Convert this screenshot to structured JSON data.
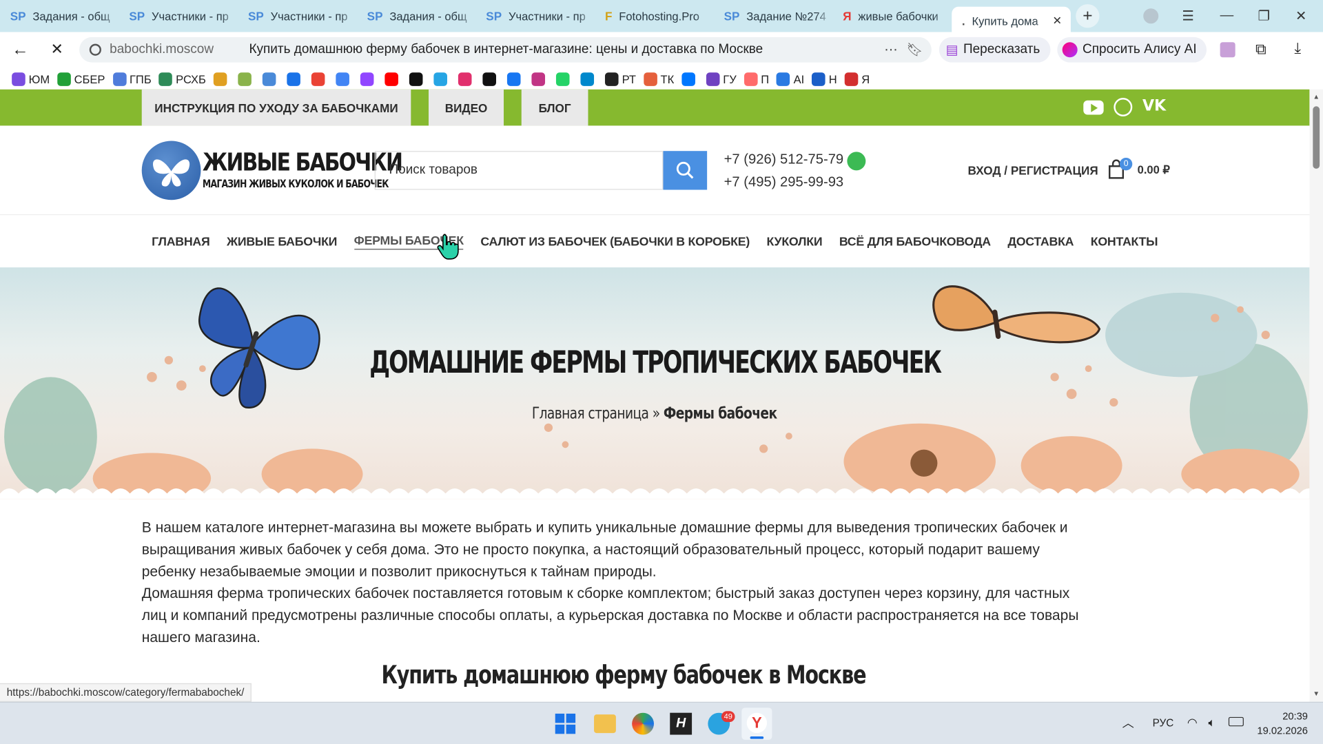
{
  "browser": {
    "tabs": [
      {
        "label": "Задания - общ",
        "favicon": "SP"
      },
      {
        "label": "Участники - пр",
        "favicon": "SP"
      },
      {
        "label": "Участники - пр",
        "favicon": "SP"
      },
      {
        "label": "Задания - общ",
        "favicon": "SP"
      },
      {
        "label": "Участники - пр",
        "favicon": "SP"
      },
      {
        "label": "Fotohosting.Pro",
        "favicon": "F"
      },
      {
        "label": "Задание №274",
        "favicon": "SP"
      },
      {
        "label": "живые бабочки",
        "favicon": "Я"
      },
      {
        "label": "Купить дома",
        "favicon": "."
      }
    ],
    "url_domain": "babochki.moscow",
    "page_title": "Купить домашнюю ферму бабочек в интернет-магазине: цены и доставка по Москве",
    "retell_label": "Пересказать",
    "alice_label": "Спросить Алису AI",
    "bookmarks": [
      "ЮМ",
      "СБЕР",
      "ГПБ",
      "РСХБ",
      "",
      "",
      "",
      "",
      "",
      "",
      "",
      "",
      "",
      "",
      "",
      "",
      "",
      "",
      "",
      "",
      "РТ",
      "ТК",
      "",
      "ГУ",
      "П",
      "AI",
      "Н",
      "Я"
    ],
    "status_url": "https://babochki.moscow/category/fermababochek/"
  },
  "site": {
    "top_links": [
      "ИНСТРУКЦИЯ ПО УХОДУ ЗА БАБОЧКАМИ",
      "ВИДЕО",
      "БЛОГ"
    ],
    "logo_title": "ЖИВЫЕ БАБОЧКИ",
    "logo_subtitle": "МАГАЗИН ЖИВЫХ КУКОЛОК И БАБОЧЕК",
    "search_placeholder": "Поиск товаров",
    "phone1": "+7 (926) 512-75-79",
    "phone2": "+7 (495) 295-99-93",
    "login": "ВХОД / РЕГИСТРАЦИЯ",
    "cart_count": "0",
    "cart_total": "0.00 ₽",
    "nav": [
      "ГЛАВНАЯ",
      "ЖИВЫЕ БАБОЧКИ",
      "ФЕРМЫ БАБОЧЕК",
      "САЛЮТ ИЗ БАБОЧЕК (БАБОЧКИ В КОРОБКЕ)",
      "КУКОЛКИ",
      "ВСЁ ДЛЯ БАБОЧКОВОДА",
      "ДОСТАВКА",
      "КОНТАКТЫ"
    ],
    "hero_title": "ДОМАШНИЕ ФЕРМЫ ТРОПИЧЕСКИХ БАБОЧЕК",
    "breadcrumb_home": "Главная страница",
    "breadcrumb_sep": "»",
    "breadcrumb_current": "Фермы бабочек",
    "para1": "В нашем каталоге интернет-магазина вы можете выбрать и купить уникальные домашние фермы для выведения тропических бабочек и выращивания живых бабочек у себя дома. Это не просто покупка, а настоящий образовательный процесс, который подарит вашему ребенку незабываемые эмоции и позволит прикоснуться к тайнам природы.",
    "para2": "Домашняя ферма тропических бабочек поставляется готовым к сборке комплектом; быстрый заказ доступен через корзину, для частных лиц и компаний предусмотрены  различные способы оплаты, а курьерская доставка по Москве и области распространяется на все товары нашего магазина.",
    "section_title": "Купить домашнюю ферму бабочек в Москве"
  },
  "taskbar": {
    "lang": "РУС",
    "time": "20:39",
    "date": "19.02.2026",
    "telegram_badge": "49"
  }
}
